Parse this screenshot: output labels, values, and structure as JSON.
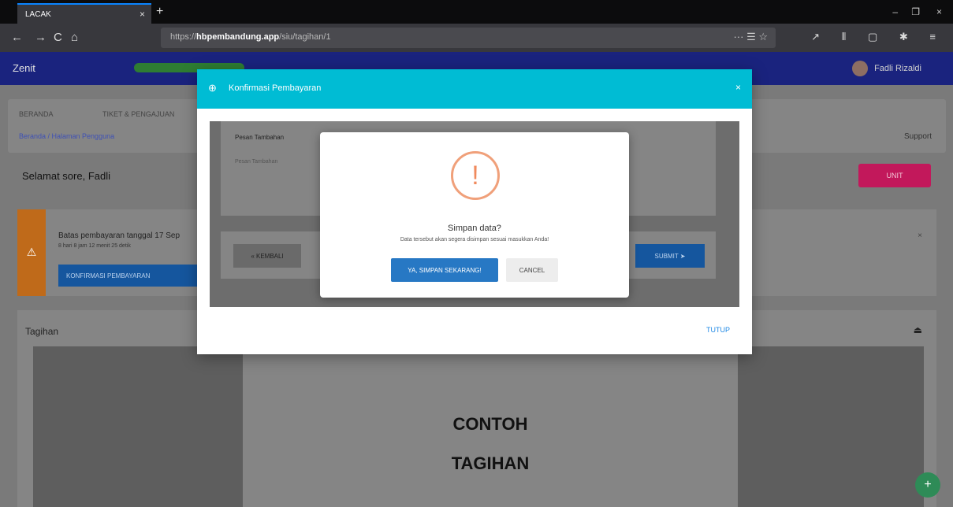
{
  "browser": {
    "tab_title": "LACAK",
    "tab_close": "×",
    "new_tab": "+",
    "url_prefix": "https://",
    "url_host": "hbpembandung.app",
    "url_path": "/siu/tagihan/1",
    "url_actions": "··· ☰ ☆",
    "window_controls": {
      "minimize": "–",
      "maximize": "❐",
      "close": "×"
    },
    "nav": {
      "back": "←",
      "forward": "→",
      "reload": "C",
      "home": "⌂"
    },
    "toolbar_icons": "↗ ⦀ ▢ ✱ ≡"
  },
  "app": {
    "brand": "Zenit",
    "user_name": "Fadli Rizaldi",
    "menu": [
      "BERANDA",
      "TIKET & PENGAJUAN"
    ],
    "breadcrumb": "Beranda / Halaman Pengguna",
    "support": "Support",
    "greeting": "Selamat sore, Fadli",
    "unit_button": "UNIT",
    "alert": {
      "title": "Batas pembayaran tanggal 17 Sep",
      "subtitle": "8 hari 8 jam 12 menit 25 detik",
      "button": "KONFIRMASI PEMBAYARAN",
      "icon": "⚠",
      "close": "×"
    },
    "tagihan": {
      "title": "Tagihan",
      "paper_lines": [
        "CONTOH",
        "TAGIHAN"
      ]
    },
    "fab": "+"
  },
  "modal": {
    "title": "Konfirmasi Pembayaran",
    "close": "×",
    "textarea_label": "Pesan Tambahan",
    "textarea_placeholder": "Pesan Tambahan",
    "back_button": "« KEMBALI",
    "submit_button": "SUBMIT",
    "close_button": "TUTUP"
  },
  "confirm": {
    "icon": "!",
    "title": "Simpan data?",
    "text": "Data tersebut akan segera disimpan sesuai masukkan Anda!",
    "confirm_button": "YA, SIMPAN SEKARANG!",
    "cancel_button": "CANCEL"
  },
  "colors": {
    "modal_header": "#00bcd4",
    "primary_button": "#2778c4",
    "warning_icon": "#f08a5d",
    "topbar": "#1a237e"
  }
}
